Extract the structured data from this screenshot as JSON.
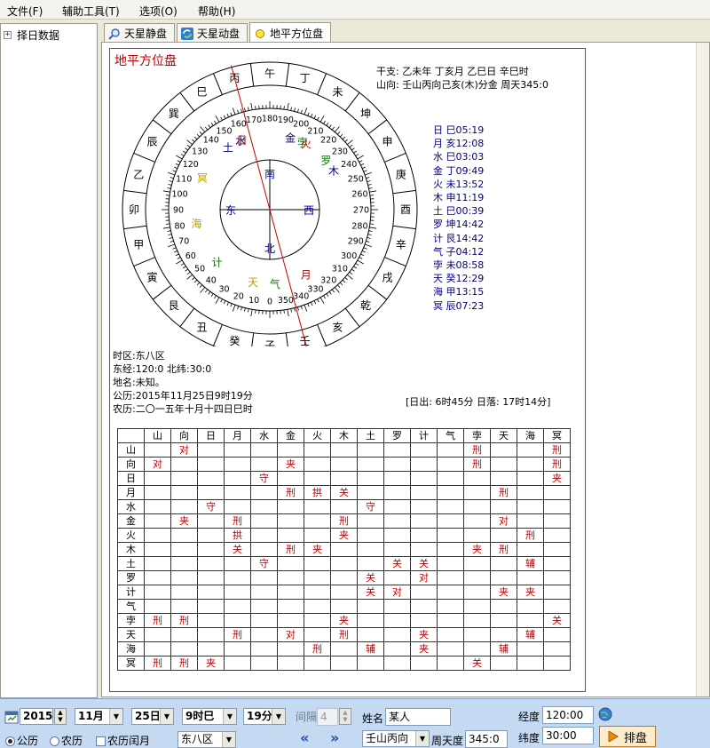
{
  "menu": [
    "文件(F)",
    "辅助工具(T)",
    "选项(O)",
    "帮助(H)"
  ],
  "tree": {
    "expander": "+",
    "label": "择日数据"
  },
  "tabs": [
    "天星静盘",
    "天星动盘",
    "地平方位盘"
  ],
  "chart": {
    "title": "地平方位盘",
    "ganzhi": "干支: 乙未年  丁亥月  乙巳日  辛巳时",
    "shanxiang": "山向: 壬山丙向己亥(木)分金   周天345:0",
    "center": {
      "n": "北",
      "s": "南",
      "e": "东",
      "w": "西"
    },
    "mountains": [
      "子",
      "癸",
      "丑",
      "艮",
      "寅",
      "甲",
      "卯",
      "乙",
      "辰",
      "巽",
      "巳",
      "丙",
      "午",
      "丁",
      "未",
      "坤",
      "申",
      "庚",
      "酉",
      "辛",
      "戌",
      "乾",
      "亥",
      "壬"
    ],
    "degree_labels": [
      "0",
      "10",
      "20",
      "30",
      "40",
      "50",
      "60",
      "70",
      "80",
      "90",
      "100",
      "110",
      "120",
      "130",
      "140",
      "150",
      "160",
      "170",
      "180",
      "190",
      "200",
      "210",
      "220",
      "230",
      "240",
      "250",
      "260",
      "270",
      "280",
      "290",
      "300",
      "310",
      "320",
      "330",
      "340",
      "350"
    ],
    "wheel_planets": [
      {
        "label": "水",
        "deg": 157,
        "color": "#000080"
      },
      {
        "label": "日",
        "deg": 158,
        "color": "#c00000"
      },
      {
        "label": "土",
        "deg": 146,
        "color": "#000080"
      },
      {
        "label": "冥",
        "deg": 115,
        "color": "#b8a000"
      },
      {
        "label": "海",
        "deg": 79,
        "color": "#b8a000"
      },
      {
        "label": "计",
        "deg": 45,
        "color": "#008000"
      },
      {
        "label": "天",
        "deg": 13,
        "color": "#b8a000"
      },
      {
        "label": "气",
        "deg": -4,
        "color": "#008000"
      },
      {
        "label": "月",
        "deg": -29,
        "color": "#c00000"
      },
      {
        "label": "金",
        "deg": 196,
        "color": "#000080"
      },
      {
        "label": "孛",
        "deg": 206,
        "color": "#008000"
      },
      {
        "label": "火",
        "deg": 209,
        "color": "#c00000"
      },
      {
        "label": "罗",
        "deg": 229,
        "color": "#008000"
      },
      {
        "label": "木",
        "deg": 239,
        "color": "#000080"
      }
    ],
    "planet_list": [
      "日 巳05:19",
      "月 亥12:08",
      "水 巳03:03",
      "金 丁09:49",
      "火 未13:52",
      "木 申11:19",
      "土 巳00:39",
      "罗 坤14:42",
      "计 艮14:42",
      "气 子04:12",
      "孛 未08:58",
      "天 癸12:29",
      "海 甲13:15",
      "冥 辰07:23"
    ],
    "bottom_info": [
      "时区:东八区",
      "东经:120:0 北纬:30:0",
      "地名:未知。",
      "公历:2015年11月25日9时19分",
      "农历:二〇一五年十月十四日巳时"
    ],
    "sun_times": "[日出: 6时45分   日落: 17时14分]",
    "colors": {
      "title": "#c00000",
      "needle": "#cc0000",
      "aspect": "#c00000"
    }
  },
  "aspects": {
    "headers": [
      "山",
      "向",
      "日",
      "月",
      "水",
      "金",
      "火",
      "木",
      "土",
      "罗",
      "计",
      "气",
      "孛",
      "天",
      "海",
      "冥"
    ],
    "rows": [
      {
        "label": "山",
        "cells": [
          "",
          "对",
          "",
          "",
          "",
          "",
          "",
          "",
          "",
          "",
          "",
          "",
          "刑",
          "",
          "",
          "刑"
        ]
      },
      {
        "label": "向",
        "cells": [
          "对",
          "",
          "",
          "",
          "",
          "夹",
          "",
          "",
          "",
          "",
          "",
          "",
          "刑",
          "",
          "",
          "刑"
        ]
      },
      {
        "label": "日",
        "cells": [
          "",
          "",
          "",
          "",
          "守",
          "",
          "",
          "",
          "",
          "",
          "",
          "",
          "",
          "",
          "",
          "夹"
        ]
      },
      {
        "label": "月",
        "cells": [
          "",
          "",
          "",
          "",
          "",
          "刑",
          "拱",
          "关",
          "",
          "",
          "",
          "",
          "",
          "刑",
          "",
          ""
        ]
      },
      {
        "label": "水",
        "cells": [
          "",
          "",
          "守",
          "",
          "",
          "",
          "",
          "",
          "守",
          "",
          "",
          "",
          "",
          "",
          "",
          ""
        ]
      },
      {
        "label": "金",
        "cells": [
          "",
          "夹",
          "",
          "刑",
          "",
          "",
          "",
          "刑",
          "",
          "",
          "",
          "",
          "",
          "对",
          "",
          ""
        ]
      },
      {
        "label": "火",
        "cells": [
          "",
          "",
          "",
          "拱",
          "",
          "",
          "",
          "夹",
          "",
          "",
          "",
          "",
          "",
          "",
          "刑",
          ""
        ]
      },
      {
        "label": "木",
        "cells": [
          "",
          "",
          "",
          "关",
          "",
          "刑",
          "夹",
          "",
          "",
          "",
          "",
          "",
          "夹",
          "刑",
          "",
          ""
        ]
      },
      {
        "label": "土",
        "cells": [
          "",
          "",
          "",
          "",
          "守",
          "",
          "",
          "",
          "",
          "关",
          "关",
          "",
          "",
          "",
          "辅",
          ""
        ]
      },
      {
        "label": "罗",
        "cells": [
          "",
          "",
          "",
          "",
          "",
          "",
          "",
          "",
          "关",
          "",
          "对",
          "",
          "",
          "",
          "",
          ""
        ]
      },
      {
        "label": "计",
        "cells": [
          "",
          "",
          "",
          "",
          "",
          "",
          "",
          "",
          "关",
          "对",
          "",
          "",
          "",
          "夹",
          "夹",
          ""
        ]
      },
      {
        "label": "气",
        "cells": [
          "",
          "",
          "",
          "",
          "",
          "",
          "",
          "",
          "",
          "",
          "",
          "",
          "",
          "",
          "",
          ""
        ]
      },
      {
        "label": "孛",
        "cells": [
          "刑",
          "刑",
          "",
          "",
          "",
          "",
          "",
          "夹",
          "",
          "",
          "",
          "",
          "",
          "",
          "",
          "关"
        ]
      },
      {
        "label": "天",
        "cells": [
          "",
          "",
          "",
          "刑",
          "",
          "对",
          "",
          "刑",
          "",
          "",
          "夹",
          "",
          "",
          "",
          "辅",
          ""
        ]
      },
      {
        "label": "海",
        "cells": [
          "",
          "",
          "",
          "",
          "",
          "",
          "刑",
          "",
          "辅",
          "",
          "夹",
          "",
          "",
          "辅",
          "",
          ""
        ]
      },
      {
        "label": "冥",
        "cells": [
          "刑",
          "刑",
          "夹",
          "",
          "",
          "",
          "",
          "",
          "",
          "",
          "",
          "",
          "关",
          "",
          "",
          ""
        ]
      }
    ]
  },
  "bottom": {
    "year": "2015",
    "month": "11月",
    "day": "25日",
    "hour": "9时巳",
    "minute": "19分",
    "interval_label": "间隔",
    "interval_value": "4",
    "name_label": "姓名",
    "name_value": "某人",
    "longitude_label": "经度",
    "longitude_value": "120:00",
    "latitude_label": "纬度",
    "latitude_value": "30:00",
    "radio_solar": "公历",
    "radio_lunar": "农历",
    "leap_label": "农历闰月",
    "tz_value": "东八区",
    "prev": "«",
    "next": "»",
    "mountain_value": "壬山丙向",
    "zhoutian_label": "周天度",
    "zhoutian_value": "345:0",
    "submit": "排盘"
  }
}
